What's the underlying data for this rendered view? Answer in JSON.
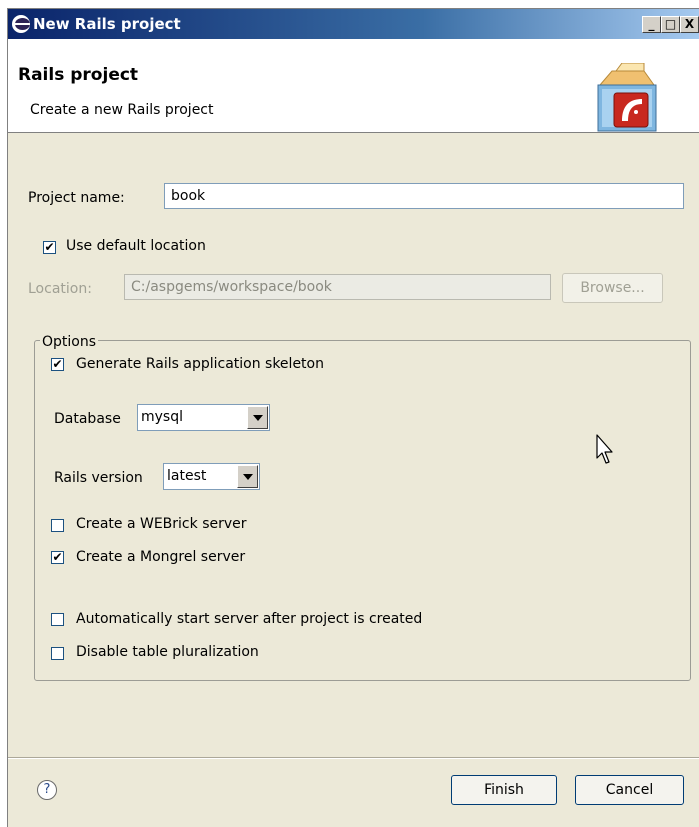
{
  "window": {
    "title": "New Rails project",
    "min_btn": "_",
    "max_btn": "□",
    "close_btn": "X"
  },
  "header": {
    "title": "Rails project",
    "subtitle": "Create a new Rails project"
  },
  "form": {
    "project_name_label": "Project name:",
    "project_name_value": "book",
    "use_default_location_label": "Use default location",
    "use_default_location_checked": true,
    "location_label": "Location:",
    "location_value": "C:/aspgems/workspace/book",
    "browse_label": "Browse..."
  },
  "options": {
    "legend": "Options",
    "generate_skeleton_label": "Generate Rails application skeleton",
    "generate_skeleton_checked": true,
    "database_label": "Database",
    "database_value": "mysql",
    "rails_version_label": "Rails version",
    "rails_version_value": "latest",
    "webrick_label": "Create a WEBrick server",
    "webrick_checked": false,
    "mongrel_label": "Create a Mongrel server",
    "mongrel_checked": true,
    "autostart_label": "Automatically start server after project is created",
    "autostart_checked": false,
    "pluralization_label": "Disable table pluralization",
    "pluralization_checked": false
  },
  "footer": {
    "help_symbol": "?",
    "finish_label": "Finish",
    "cancel_label": "Cancel"
  },
  "icons": {
    "app": "eclipse-icon",
    "banner": "rails-project-banner-icon",
    "cursor": "mouse-pointer-icon",
    "check": "checkmark-icon",
    "help": "help-icon",
    "dropdown": "chevron-down-icon"
  },
  "colors": {
    "titlebar_start": "#0a246a",
    "titlebar_end": "#a6caf0",
    "dialog_bg": "#ece9d8"
  }
}
